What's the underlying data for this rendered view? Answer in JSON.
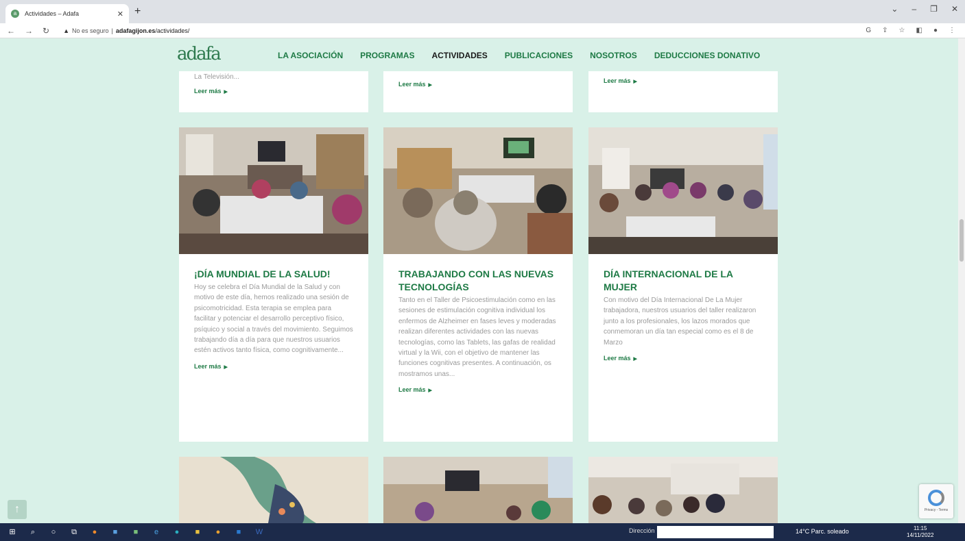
{
  "browser": {
    "tab_title": "Actividades – Adafa",
    "security_label": "No es seguro",
    "url_domain": "adafagijon.es",
    "url_path": "/actividades/"
  },
  "site": {
    "logo_text": "adafa",
    "menu": [
      {
        "label": "LA ASOCIACIÓN",
        "active": false
      },
      {
        "label": "PROGRAMAS",
        "active": false
      },
      {
        "label": "ACTIVIDADES",
        "active": true
      },
      {
        "label": "PUBLICACIONES",
        "active": false
      },
      {
        "label": "NOSOTROS",
        "active": false
      },
      {
        "label": "DEDUCCIONES DONATIVO",
        "active": false
      }
    ],
    "read_more": "Leer más",
    "top_cards": [
      {
        "snippet": "La Televisión..."
      },
      {
        "snippet": ""
      },
      {
        "snippet": ""
      }
    ],
    "cards": [
      {
        "title": "¡DÍA MUNDIAL DE LA SALUD!",
        "text": "Hoy se celebra el Día Mundial de la Salud y con motivo de este día, hemos realizado una sesión de psicomotricidad. Esta terapia se emplea para facilitar y potenciar el desarrollo perceptivo físico, psíquico y social a través del movimiento. Seguimos trabajando día a día para que nuestros usuarios estén activos tanto física, como cognitivamente..."
      },
      {
        "title": "TRABAJANDO CON LAS NUEVAS TECNOLOGÍAS",
        "text": "Tanto en el Taller de Psicoestimulación como en las sesiones de estimulación cognitiva individual los enfermos de Alzheimer en fases leves y moderadas realizan diferentes actividades con las nuevas tecnologías, como las Tablets, las gafas de realidad virtual y la Wii, con el objetivo de mantener las funciones cognitivas presentes. A continuación, os mostramos unas..."
      },
      {
        "title": "DÍA INTERNACIONAL DE LA MUJER",
        "text": "Con motivo del Día Internacional De La Mujer trabajadora, nuestros usuarios del taller realizaron junto a los profesionales, los lazos morados que conmemoran un día tan especial como es el 8 de Marzo"
      }
    ]
  },
  "taskbar": {
    "address_label": "Dirección",
    "weather": "14°C  Parc. soleado",
    "time": "11:15",
    "date": "14/11/2022"
  },
  "recaptcha_text": "Privacy - Terms"
}
